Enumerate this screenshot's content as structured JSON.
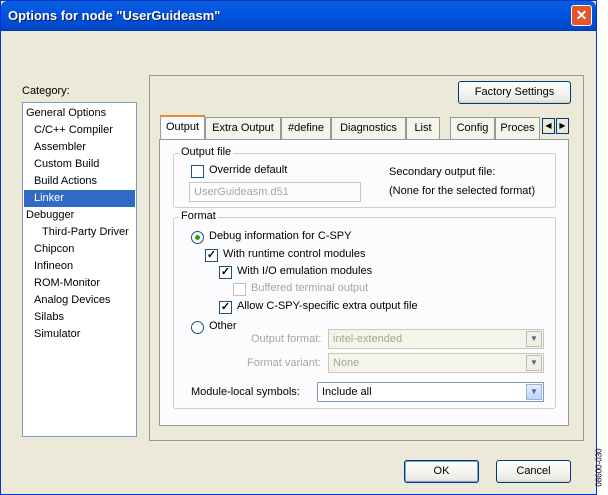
{
  "window": {
    "title": "Options for node \"UserGuideasm\"",
    "close_glyph": "✕"
  },
  "category": {
    "label": "Category:",
    "items": [
      {
        "label": "General Options",
        "indent": 0
      },
      {
        "label": "C/C++ Compiler",
        "indent": 1
      },
      {
        "label": "Assembler",
        "indent": 1
      },
      {
        "label": "Custom Build",
        "indent": 1
      },
      {
        "label": "Build Actions",
        "indent": 1
      },
      {
        "label": "Linker",
        "indent": 1,
        "selected": true
      },
      {
        "label": "Debugger",
        "indent": 0
      },
      {
        "label": "Third-Party Driver",
        "indent": 2
      },
      {
        "label": "Chipcon",
        "indent": 1
      },
      {
        "label": "Infineon",
        "indent": 1
      },
      {
        "label": "ROM-Monitor",
        "indent": 1
      },
      {
        "label": "Analog Devices",
        "indent": 1
      },
      {
        "label": "Silabs",
        "indent": 1
      },
      {
        "label": "Simulator",
        "indent": 1
      }
    ]
  },
  "factory_settings": "Factory Settings",
  "tabs": [
    "Output",
    "Extra Output",
    "#define",
    "Diagnostics",
    "List",
    "Config",
    "Proces"
  ],
  "tab_scroll": {
    "left": "◀",
    "right": "▶"
  },
  "output_file": {
    "group_title": "Output file",
    "override_label": "Override default",
    "override_checked": false,
    "filename_value": "UserGuideasm.d51",
    "secondary_label": "Secondary output file:",
    "secondary_value": "(None for the selected format)"
  },
  "format": {
    "group_title": "Format",
    "debug_label": "Debug information for C-SPY",
    "runtime_label": "With runtime control modules",
    "io_label": "With I/O emulation modules",
    "buffered_label": "Buffered terminal output",
    "allow_label": "Allow C-SPY-specific extra output file",
    "other_label": "Other",
    "output_format_label": "Output format:",
    "output_format_value": "intel-extended",
    "format_variant_label": "Format variant:",
    "format_variant_value": "None",
    "module_local_label": "Module-local symbols:",
    "module_local_value": "Include all",
    "check_mark": "✓"
  },
  "buttons": {
    "ok": "OK",
    "cancel": "Cancel"
  },
  "side_code": "08600-030"
}
